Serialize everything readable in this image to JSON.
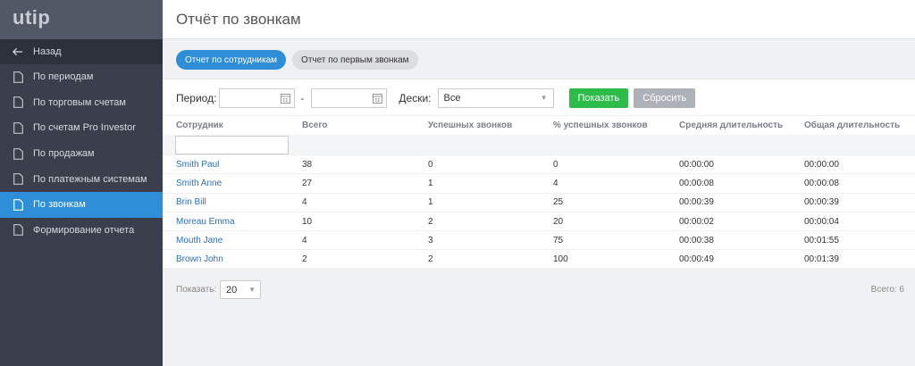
{
  "sidebar": {
    "logo": "utip",
    "back_label": "Назад",
    "items": [
      {
        "label": "По периодам"
      },
      {
        "label": "По торговым счетам"
      },
      {
        "label": "По счетам Pro Investor"
      },
      {
        "label": "По продажам"
      },
      {
        "label": "По платежным системам"
      },
      {
        "label": "По звонкам"
      },
      {
        "label": "Формирование отчета"
      }
    ],
    "active_index": 5
  },
  "header": {
    "title": "Отчёт по звонкам"
  },
  "tabs": [
    {
      "label": "Отчет по сотрудникам",
      "active": true
    },
    {
      "label": "Отчет по первым звонкам",
      "active": false
    }
  ],
  "filters": {
    "period_label": "Период:",
    "date_from": "",
    "separator": "-",
    "date_to": "",
    "desks_label": "Дески:",
    "desks_value": "Все",
    "show_button": "Показать",
    "reset_button": "Сбросить"
  },
  "table": {
    "columns": [
      "Сотрудник",
      "Всего",
      "Успешных звонков",
      "% успешных звонков",
      "Средняя длительность",
      "Общая длительность"
    ],
    "filter_value": "",
    "rows": [
      [
        "Smith Paul",
        "38",
        "0",
        "0",
        "00:00:00",
        "00:00:00"
      ],
      [
        "Smith Anne",
        "27",
        "1",
        "4",
        "00:00:08",
        "00:00:08"
      ],
      [
        "Brin Bill",
        "4",
        "1",
        "25",
        "00:00:39",
        "00:00:39"
      ],
      [
        "Moreau Emma",
        "10",
        "2",
        "20",
        "00:00:02",
        "00:00:04"
      ],
      [
        "Mouth Jane",
        "4",
        "3",
        "75",
        "00:00:38",
        "00:01:55"
      ],
      [
        "Brown John",
        "2",
        "2",
        "100",
        "00:00:49",
        "00:01:39"
      ]
    ]
  },
  "footer": {
    "show_label": "Показать:",
    "page_size": "20",
    "total": "Всего: 6"
  },
  "colors": {
    "accent": "#2f8ed8",
    "sidebar_bg": "#3a3f4b",
    "green_button": "#2dbb4a",
    "link": "#2b6fb3"
  }
}
